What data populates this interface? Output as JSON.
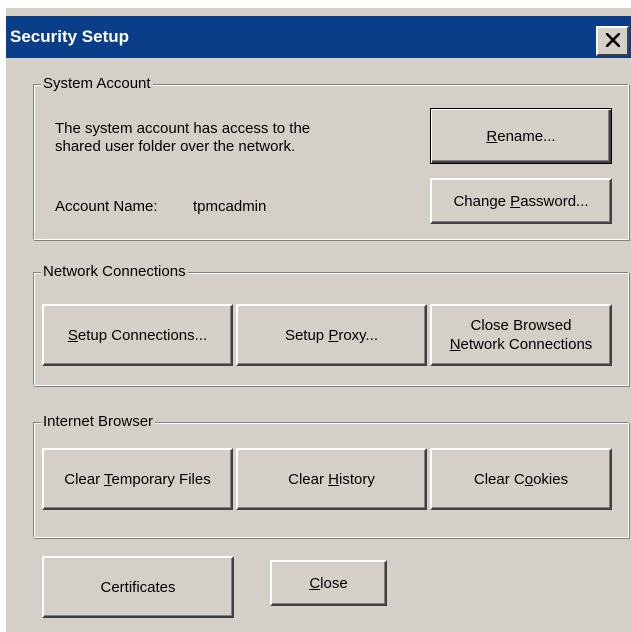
{
  "window": {
    "title": "Security Setup"
  },
  "system_account": {
    "legend": "System Account",
    "description_line1": "The system account has access to the",
    "description_line2": "shared user folder over the network.",
    "account_name_label": "Account Name:",
    "account_name_value": "tpmcadmin",
    "rename_button": {
      "before": "",
      "mnemonic": "R",
      "after": "ename..."
    },
    "change_password_button": {
      "before": "Change ",
      "mnemonic": "P",
      "after": "assword..."
    }
  },
  "network_connections": {
    "legend": "Network Connections",
    "setup_connections_button": {
      "before": "",
      "mnemonic": "S",
      "after": "etup Connections..."
    },
    "setup_proxy_button": {
      "before": "Setup ",
      "mnemonic": "P",
      "after": "roxy..."
    },
    "close_browsed_button": {
      "line1": "Close Browsed",
      "line2_before": "",
      "line2_mnemonic": "N",
      "line2_after": "etwork Connections"
    }
  },
  "internet_browser": {
    "legend": "Internet Browser",
    "clear_temp_button": {
      "before": "Clear ",
      "mnemonic": "T",
      "after": "emporary Files"
    },
    "clear_history_button": {
      "before": "Clear ",
      "mnemonic": "H",
      "after": "istory"
    },
    "clear_cookies_button": {
      "before": "Clear C",
      "mnemonic": "o",
      "after": "okies"
    }
  },
  "footer": {
    "certificates_button": "Certificates",
    "close_button": {
      "before": "",
      "mnemonic": "C",
      "after": "lose"
    }
  },
  "colors": {
    "titlebar": "#0a3e88",
    "face": "#d4d0c8",
    "shadow": "#808080",
    "highlight": "#ffffff"
  },
  "icons": {
    "close": "close-icon"
  }
}
